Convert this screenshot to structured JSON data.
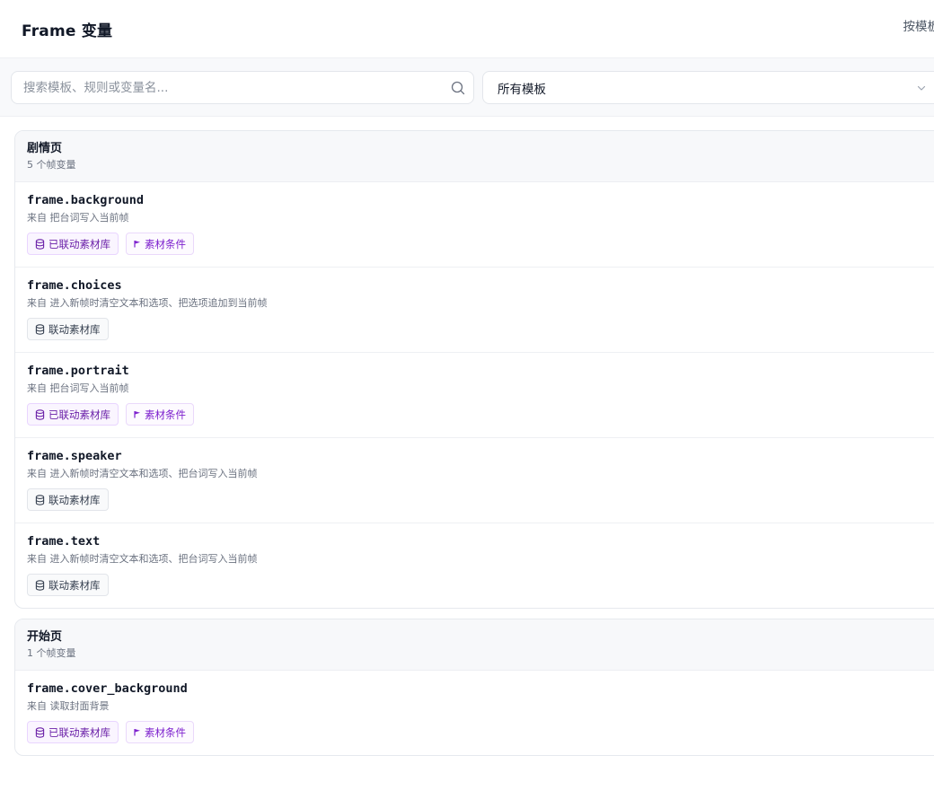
{
  "header": {
    "title": "Frame 变量",
    "right_action": "按模板"
  },
  "filters": {
    "search_placeholder": "搜索模板、规则或变量名...",
    "template_select": "所有模板"
  },
  "groups": [
    {
      "name": "剧情页",
      "count": "5 个帧变量",
      "vars": [
        {
          "name": "frame.background",
          "source": "来自 把台词写入当前帧",
          "tags": [
            {
              "type": "linked",
              "label": "已联动素材库"
            },
            {
              "type": "condition",
              "label": "素材条件"
            }
          ]
        },
        {
          "name": "frame.choices",
          "source": "来自 进入新帧时清空文本和选项、把选项追加到当前帧",
          "tags": [
            {
              "type": "unlinked",
              "label": "联动素材库"
            }
          ]
        },
        {
          "name": "frame.portrait",
          "source": "来自 把台词写入当前帧",
          "tags": [
            {
              "type": "linked",
              "label": "已联动素材库"
            },
            {
              "type": "condition",
              "label": "素材条件"
            }
          ]
        },
        {
          "name": "frame.speaker",
          "source": "来自 进入新帧时清空文本和选项、把台词写入当前帧",
          "tags": [
            {
              "type": "unlinked",
              "label": "联动素材库"
            }
          ]
        },
        {
          "name": "frame.text",
          "source": "来自 进入新帧时清空文本和选项、把台词写入当前帧",
          "tags": [
            {
              "type": "unlinked",
              "label": "联动素材库"
            }
          ]
        }
      ]
    },
    {
      "name": "开始页",
      "count": "1 个帧变量",
      "vars": [
        {
          "name": "frame.cover_background",
          "source": "来自 读取封面背景",
          "tags": [
            {
              "type": "linked",
              "label": "已联动素材库"
            },
            {
              "type": "condition",
              "label": "素材条件"
            }
          ]
        }
      ]
    }
  ],
  "icons": {
    "search": "search-icon",
    "select": "chevron-down-icon",
    "linked": "database-icon",
    "unlinked": "database-icon",
    "condition": "flag-icon"
  },
  "colors": {
    "accent_purple": "#7e22ce",
    "linked_bg": "#faf5ff",
    "linked_border": "#e9d5ff",
    "text_muted": "#6b7280"
  }
}
